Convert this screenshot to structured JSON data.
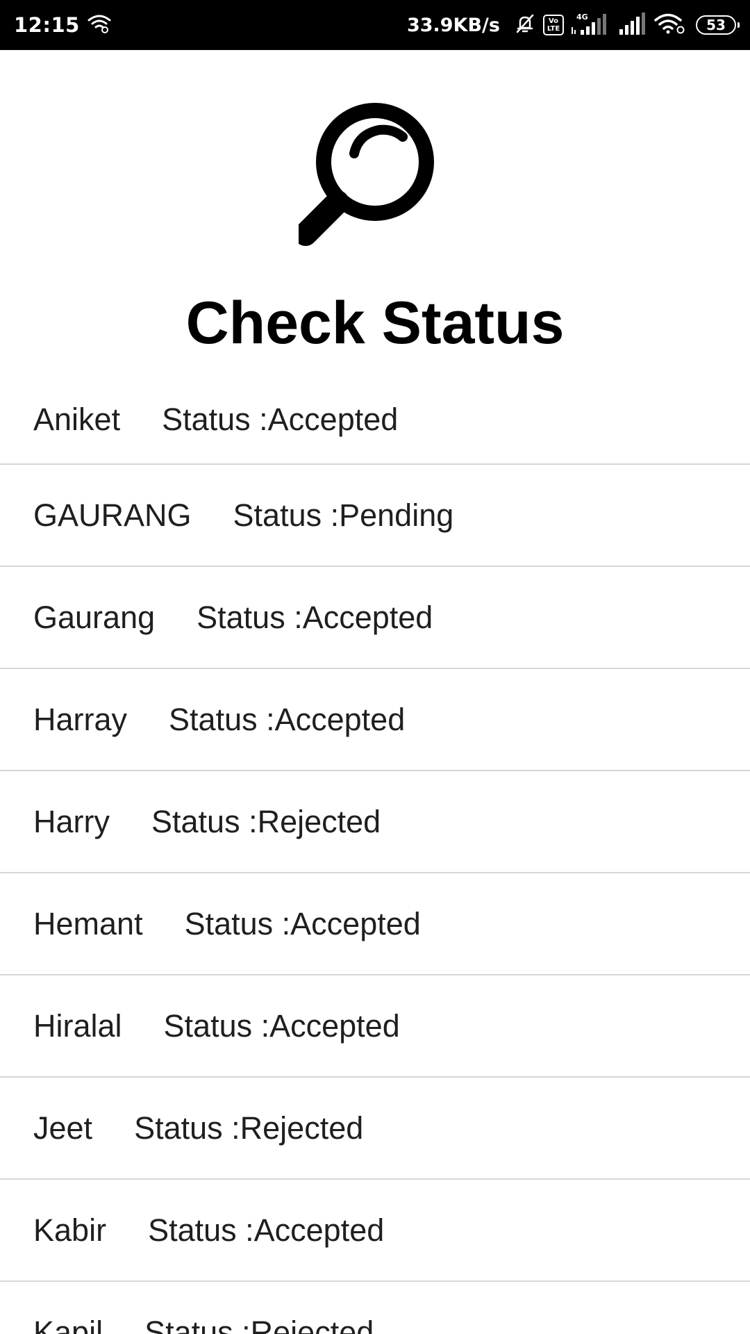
{
  "status_bar": {
    "time": "12:15",
    "network_speed": "33.9KB/s",
    "volte_top": "Vo",
    "volte_bottom": "LTE",
    "network_type": "4G",
    "battery": "53"
  },
  "header": {
    "icon": "search-icon",
    "title": "Check Status"
  },
  "list": {
    "items": [
      {
        "name": "Aniket",
        "status": "Status :Accepted"
      },
      {
        "name": "GAURANG",
        "status": "Status :Pending"
      },
      {
        "name": "Gaurang",
        "status": "Status :Accepted"
      },
      {
        "name": "Harray",
        "status": "Status :Accepted"
      },
      {
        "name": "Harry",
        "status": "Status :Rejected"
      },
      {
        "name": "Hemant",
        "status": "Status :Accepted"
      },
      {
        "name": "Hiralal",
        "status": "Status :Accepted"
      },
      {
        "name": "Jeet",
        "status": "Status :Rejected"
      },
      {
        "name": "Kabir",
        "status": "Status :Accepted"
      },
      {
        "name": "Kapil",
        "status": "Status :Rejected"
      }
    ]
  }
}
